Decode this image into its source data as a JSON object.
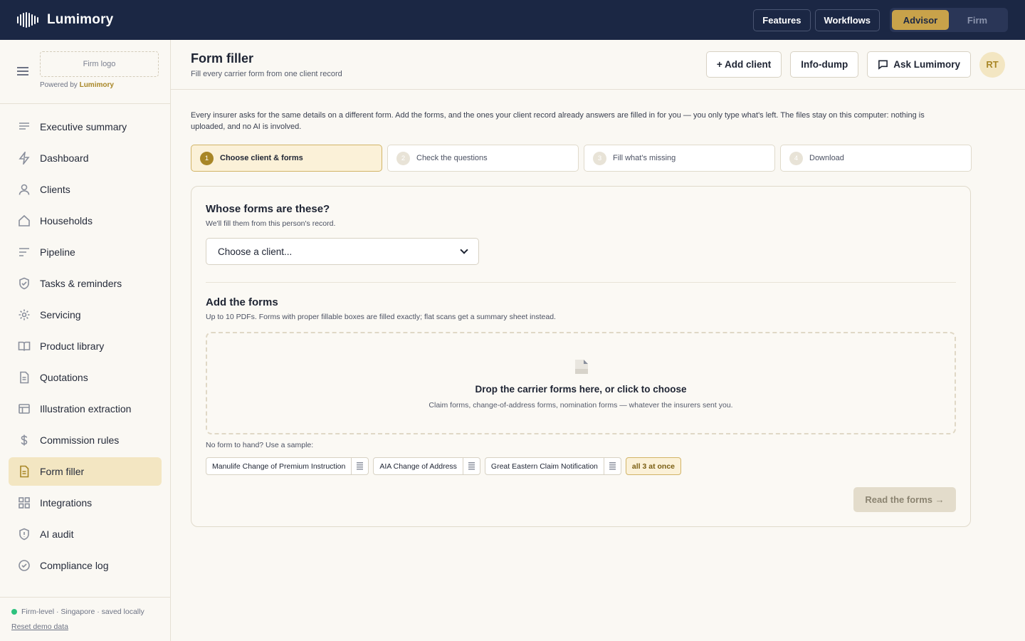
{
  "app": {
    "name": "Lumimory"
  },
  "topnav": {
    "features": "Features",
    "workflows": "Workflows",
    "mode_advisor": "Advisor",
    "mode_firm": "Firm"
  },
  "sidebar": {
    "firm_logo": "Firm logo",
    "powered_prefix": "Powered by",
    "powered_brand": "Lumimory",
    "items": [
      {
        "label": "Executive summary",
        "icon": "summary-icon"
      },
      {
        "label": "Dashboard",
        "icon": "lightning-icon"
      },
      {
        "label": "Clients",
        "icon": "person-icon"
      },
      {
        "label": "Households",
        "icon": "home-icon"
      },
      {
        "label": "Pipeline",
        "icon": "pipeline-icon"
      },
      {
        "label": "Tasks & reminders",
        "icon": "shield-check-icon"
      },
      {
        "label": "Servicing",
        "icon": "gear-icon"
      },
      {
        "label": "Product library",
        "icon": "book-icon"
      },
      {
        "label": "Quotations",
        "icon": "document-icon"
      },
      {
        "label": "Illustration extraction",
        "icon": "table-icon"
      },
      {
        "label": "Commission rules",
        "icon": "currency-icon"
      },
      {
        "label": "Form filler",
        "icon": "form-icon",
        "active": true
      },
      {
        "label": "Integrations",
        "icon": "grid-icon"
      },
      {
        "label": "AI audit",
        "icon": "shield-alert-icon"
      },
      {
        "label": "Compliance log",
        "icon": "check-circle-icon"
      }
    ],
    "status": "Firm-level · Singapore · saved locally",
    "reset": "Reset demo data"
  },
  "header": {
    "title": "Form filler",
    "subtitle": "Fill every carrier form from one client record",
    "add_client": "+ Add client",
    "info_dump": "Info-dump",
    "ask": "Ask Lumimory",
    "avatar": "RT"
  },
  "intro": "Every insurer asks for the same details on a different form. Add the forms, and the ones your client record already answers are filled in for you — you only type what's left. The files stay on this computer: nothing is uploaded, and no AI is involved.",
  "steps": [
    {
      "num": "1",
      "label": "Choose client & forms"
    },
    {
      "num": "2",
      "label": "Check the questions"
    },
    {
      "num": "3",
      "label": "Fill what's missing"
    },
    {
      "num": "4",
      "label": "Download"
    }
  ],
  "client_section": {
    "title": "Whose forms are these?",
    "subtitle": "We'll fill them from this person's record.",
    "select_value": "Choose a client..."
  },
  "forms_section": {
    "title": "Add the forms",
    "subtitle": "Up to 10 PDFs. Forms with proper fillable boxes are filled exactly; flat scans get a summary sheet instead.",
    "drop_title": "Drop the carrier forms here, or click to choose",
    "drop_sub": "Claim forms, change-of-address forms, nomination forms — whatever the insurers sent you.",
    "sample_label": "No form to hand? Use a sample:",
    "samples": [
      "Manulife Change of Premium Instruction",
      "AIA Change of Address",
      "Great Eastern Claim Notification"
    ],
    "all_samples": "all 3 at once",
    "read_button": "Read the forms →"
  },
  "colors": {
    "navy": "#1b2744",
    "gold": "#c8a24a",
    "active_bg": "#f3e6c2"
  }
}
